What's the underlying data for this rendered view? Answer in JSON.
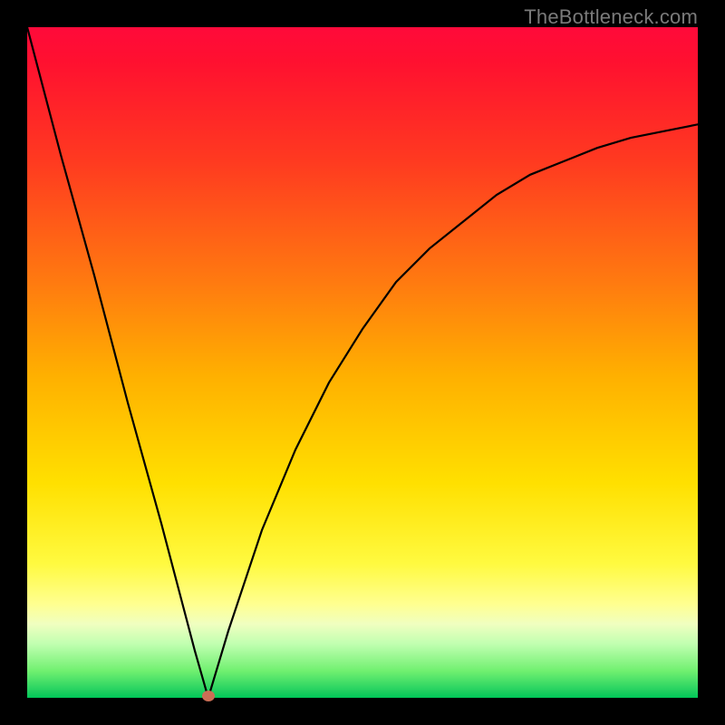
{
  "watermark": "TheBottleneck.com",
  "marker": {
    "x_pct": 27.0,
    "y_pct": 0.0
  },
  "colors": {
    "bg": "#000000",
    "curve": "#000000",
    "marker": "#cc6e55",
    "watermark": "#7a7a7a"
  },
  "chart_data": {
    "type": "line",
    "title": "",
    "xlabel": "",
    "ylabel": "",
    "xlim": [
      0,
      100
    ],
    "ylim": [
      0,
      100
    ],
    "series": [
      {
        "name": "left-branch",
        "x": [
          0,
          5,
          10,
          15,
          20,
          25,
          27
        ],
        "values": [
          100,
          81,
          63,
          44,
          26,
          7,
          0
        ]
      },
      {
        "name": "right-branch",
        "x": [
          27,
          30,
          35,
          40,
          45,
          50,
          55,
          60,
          65,
          70,
          75,
          80,
          85,
          90,
          95,
          100
        ],
        "values": [
          0,
          10,
          25,
          37,
          47,
          55,
          62,
          67,
          71,
          75,
          78,
          80,
          82,
          83.5,
          84.5,
          85.5
        ]
      }
    ],
    "annotations": [
      {
        "type": "marker",
        "x": 27,
        "y": 0
      }
    ]
  }
}
